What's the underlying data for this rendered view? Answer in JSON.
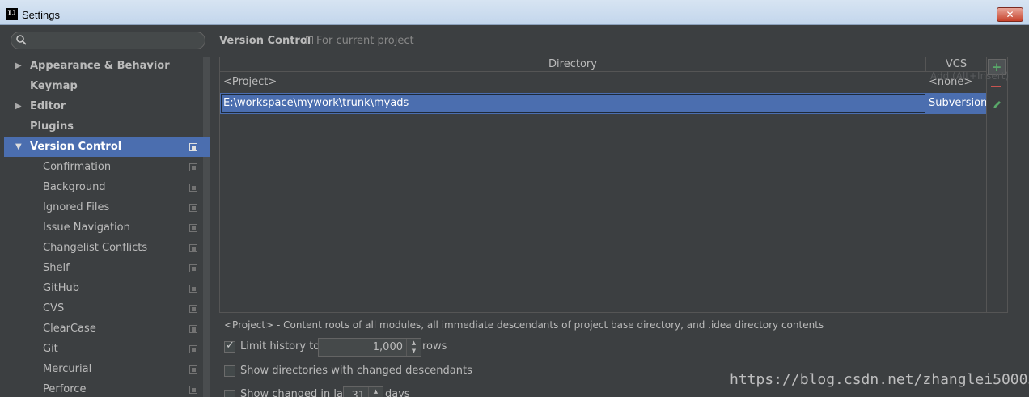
{
  "window": {
    "title": "Settings",
    "app_icon": "IJ",
    "close_label": "✕"
  },
  "search": {
    "placeholder": ""
  },
  "sidebar": {
    "items": [
      {
        "label": "Appearance & Behavior",
        "expandable": true,
        "expanded": false,
        "bold": true
      },
      {
        "label": "Keymap",
        "bold": true
      },
      {
        "label": "Editor",
        "expandable": true,
        "expanded": false,
        "bold": true
      },
      {
        "label": "Plugins",
        "bold": true
      },
      {
        "label": "Version Control",
        "expandable": true,
        "expanded": true,
        "bold": true,
        "selected": true
      },
      {
        "label": "Confirmation"
      },
      {
        "label": "Background"
      },
      {
        "label": "Ignored Files"
      },
      {
        "label": "Issue Navigation"
      },
      {
        "label": "Changelist Conflicts"
      },
      {
        "label": "Shelf"
      },
      {
        "label": "GitHub"
      },
      {
        "label": "CVS"
      },
      {
        "label": "ClearCase"
      },
      {
        "label": "Git"
      },
      {
        "label": "Mercurial"
      },
      {
        "label": "Perforce"
      }
    ]
  },
  "main": {
    "title": "Version Control",
    "subtitle": "For current project",
    "table": {
      "columns": [
        "Directory",
        "VCS"
      ],
      "rows": [
        {
          "directory": "<Project>",
          "vcs": "<none>"
        },
        {
          "directory": "E:\\workspace\\mywork\\trunk\\myads",
          "vcs": "Subversion",
          "selected": true
        }
      ],
      "add_label": "+",
      "tooltip": "Add (Alt+Insert)"
    },
    "note": "<Project> - Content roots of all modules, all immediate descendants of project base directory, and .idea directory contents",
    "limit_history": {
      "label": "Limit history to:",
      "checked": true,
      "value": "1,000",
      "suffix": "rows"
    },
    "show_dirs": {
      "label": "Show directories with changed descendants",
      "checked": false
    },
    "show_changed": {
      "label": "Show changed in last",
      "checked": false,
      "value": "31",
      "suffix": "days"
    }
  },
  "watermark": "https://blog.csdn.net/zhanglei500038",
  "colors": {
    "selection": "#4b6eaf",
    "background": "#3c3f41",
    "add": "#59a869",
    "remove": "#c75450"
  }
}
